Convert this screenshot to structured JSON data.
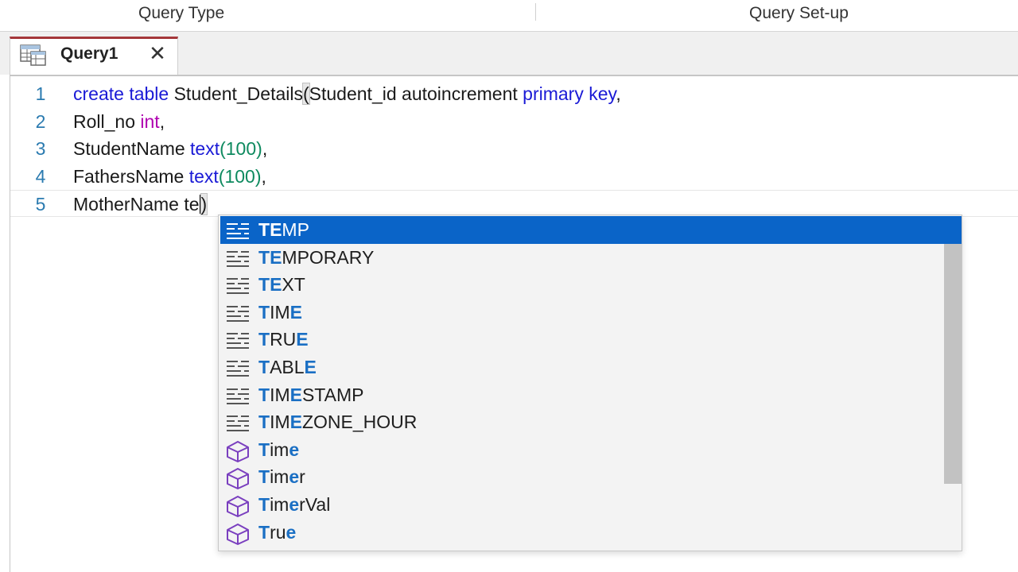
{
  "ribbon": {
    "group_query_type": "Query Type",
    "group_query_setup": "Query Set-up"
  },
  "tab": {
    "title": "Query1",
    "close": "✕"
  },
  "editor": {
    "lines": [
      {
        "no": "1",
        "parts": [
          {
            "t": "create table ",
            "c": "kw"
          },
          {
            "t": "Student_Details",
            "c": ""
          },
          {
            "t": "(",
            "c": "paren-hl"
          },
          {
            "t": "Student_id autoincrement ",
            "c": ""
          },
          {
            "t": "primary key",
            "c": "kw"
          },
          {
            "t": ",",
            "c": ""
          }
        ]
      },
      {
        "no": "2",
        "parts": [
          {
            "t": "Roll_no ",
            "c": ""
          },
          {
            "t": "int",
            "c": "tp"
          },
          {
            "t": ",",
            "c": ""
          }
        ]
      },
      {
        "no": "3",
        "parts": [
          {
            "t": "StudentName ",
            "c": ""
          },
          {
            "t": "text",
            "c": "fn"
          },
          {
            "t": "(100)",
            "c": "num"
          },
          {
            "t": ",",
            "c": ""
          }
        ]
      },
      {
        "no": "4",
        "parts": [
          {
            "t": "FathersName ",
            "c": ""
          },
          {
            "t": "text",
            "c": "fn"
          },
          {
            "t": "(100)",
            "c": "num"
          },
          {
            "t": ",",
            "c": ""
          }
        ]
      },
      {
        "no": "5",
        "parts": [
          {
            "t": "MotherName te",
            "c": ""
          },
          {
            "t": "|",
            "c": "caret"
          },
          {
            "t": ")",
            "c": "paren-hl"
          }
        ]
      }
    ]
  },
  "autocomplete": {
    "items": [
      {
        "label": "TEMP",
        "match": "TE",
        "icon": "keyword-icon",
        "selected": true
      },
      {
        "label": "TEMPORARY",
        "match": "TE",
        "icon": "keyword-icon",
        "selected": false
      },
      {
        "label": "TEXT",
        "match": "TE",
        "icon": "keyword-icon",
        "selected": false
      },
      {
        "label": "TIME",
        "match": "T E",
        "icon": "keyword-icon",
        "selected": false
      },
      {
        "label": "TRUE",
        "match": "T E",
        "icon": "keyword-icon",
        "selected": false
      },
      {
        "label": "TABLE",
        "match": "T E",
        "icon": "keyword-icon",
        "selected": false
      },
      {
        "label": "TIMESTAMP",
        "match": "T E",
        "icon": "keyword-icon",
        "selected": false
      },
      {
        "label": "TIMEZONE_HOUR",
        "match": "T E",
        "icon": "keyword-icon",
        "selected": false
      },
      {
        "label": "Time",
        "match": "T e",
        "icon": "cube-icon",
        "selected": false
      },
      {
        "label": "Timer",
        "match": "T e",
        "icon": "cube-icon",
        "selected": false
      },
      {
        "label": "TimerVal",
        "match": "T e",
        "icon": "cube-icon",
        "selected": false
      },
      {
        "label": "True",
        "match": "T e",
        "icon": "cube-icon",
        "selected": false
      }
    ]
  },
  "colors": {
    "keyword": "#1a1ad6",
    "type": "#b000b0",
    "number": "#0e8a5f",
    "match_highlight": "#1a6fc4",
    "selection": "#0a64c8",
    "tab_accent": "#a4373a"
  }
}
